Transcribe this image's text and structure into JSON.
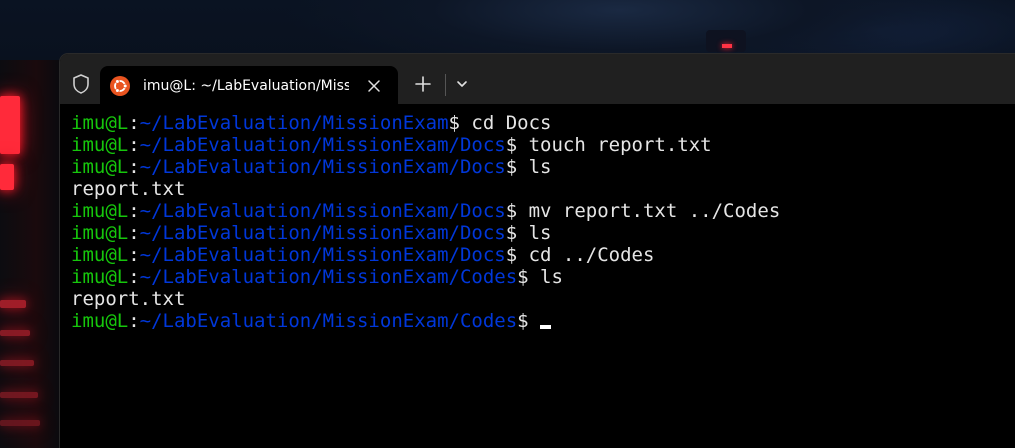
{
  "colors": {
    "user": "#16c60c",
    "path": "#0037da",
    "text": "#e5e5e5",
    "terminal_bg": "#000000",
    "tabbar_bg": "#202020",
    "ubuntu": "#e95420"
  },
  "tabs": [
    {
      "title": "imu@L: ~/LabEvaluation/MissionExam",
      "icon": "ubuntu-icon",
      "close_icon": "close-icon"
    }
  ],
  "toolbar": {
    "shield_icon": "shield-icon",
    "new_tab_icon": "plus-icon",
    "dropdown_icon": "chevron-down-icon"
  },
  "terminal": {
    "lines": [
      {
        "type": "cmd",
        "user": "imu@L",
        "sep": ":",
        "path": "~/LabEvaluation/MissionExam",
        "prompt": "$",
        "command": " cd Docs"
      },
      {
        "type": "cmd",
        "user": "imu@L",
        "sep": ":",
        "path": "~/LabEvaluation/MissionExam/Docs",
        "prompt": "$",
        "command": " touch report.txt"
      },
      {
        "type": "cmd",
        "user": "imu@L",
        "sep": ":",
        "path": "~/LabEvaluation/MissionExam/Docs",
        "prompt": "$",
        "command": " ls"
      },
      {
        "type": "out",
        "text": "report.txt"
      },
      {
        "type": "cmd",
        "user": "imu@L",
        "sep": ":",
        "path": "~/LabEvaluation/MissionExam/Docs",
        "prompt": "$",
        "command": " mv report.txt ../Codes"
      },
      {
        "type": "cmd",
        "user": "imu@L",
        "sep": ":",
        "path": "~/LabEvaluation/MissionExam/Docs",
        "prompt": "$",
        "command": " ls"
      },
      {
        "type": "cmd",
        "user": "imu@L",
        "sep": ":",
        "path": "~/LabEvaluation/MissionExam/Docs",
        "prompt": "$",
        "command": " cd ../Codes"
      },
      {
        "type": "cmd",
        "user": "imu@L",
        "sep": ":",
        "path": "~/LabEvaluation/MissionExam/Codes",
        "prompt": "$",
        "command": " ls"
      },
      {
        "type": "out",
        "text": "report.txt"
      },
      {
        "type": "cmd",
        "user": "imu@L",
        "sep": ":",
        "path": "~/LabEvaluation/MissionExam/Codes",
        "prompt": "$",
        "command": "",
        "cursor": true
      }
    ]
  }
}
